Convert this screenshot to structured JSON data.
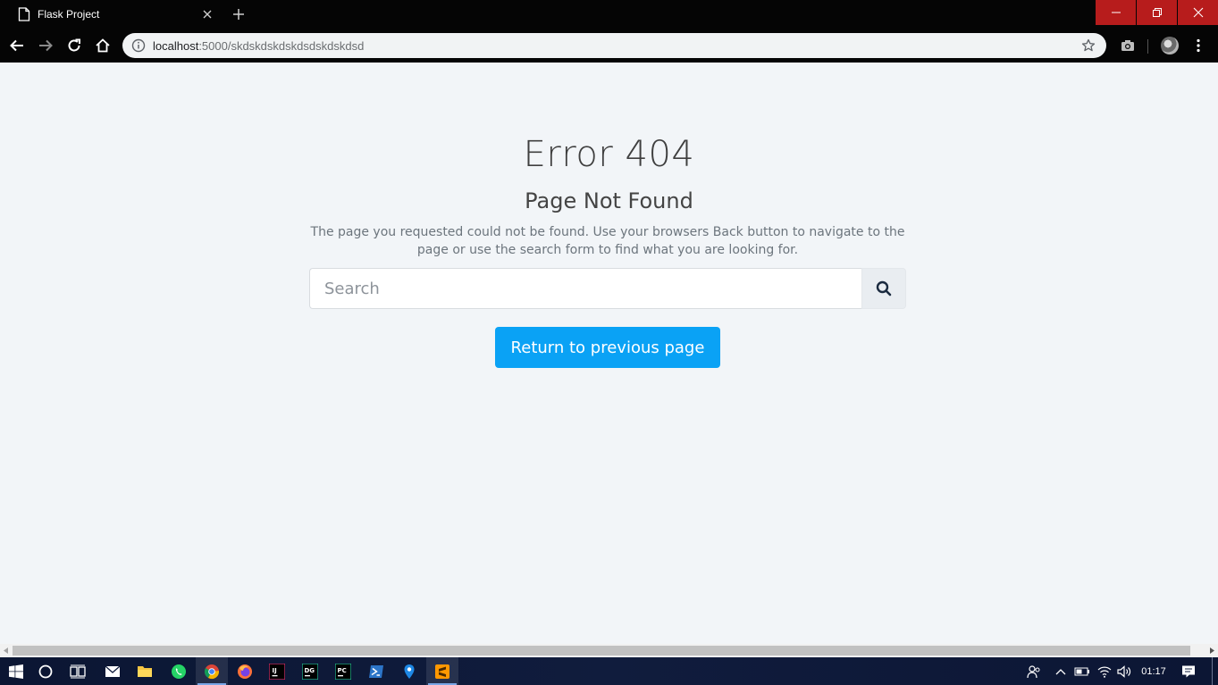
{
  "browser": {
    "tab_title": "Flask Project",
    "url_host": "localhost",
    "url_path": ":5000/skdskdskdskdsdskdskdsd"
  },
  "page": {
    "title": "Error 404",
    "subtitle": "Page Not Found",
    "message": "The page you requested could not be found. Use your browsers Back button to navigate to the page or use the search form to find what you are looking for.",
    "search_placeholder": "Search",
    "return_button": "Return to previous page"
  },
  "taskbar": {
    "clock": "01:17",
    "apps": [
      "start-icon",
      "cortana-icon",
      "task-view-icon",
      "mail-icon",
      "file-explorer-icon",
      "whatsapp-icon",
      "chrome-icon",
      "firefox-icon",
      "intellij-icon",
      "datagrip-icon",
      "pycharm-icon",
      "powershell-icon",
      "maps-icon",
      "sublime-icon"
    ]
  },
  "colors": {
    "page_bg": "#f2f5f8",
    "primary_button": "#0aa2f5",
    "window_close": "#b71c1c",
    "taskbar": "#101c3d"
  }
}
